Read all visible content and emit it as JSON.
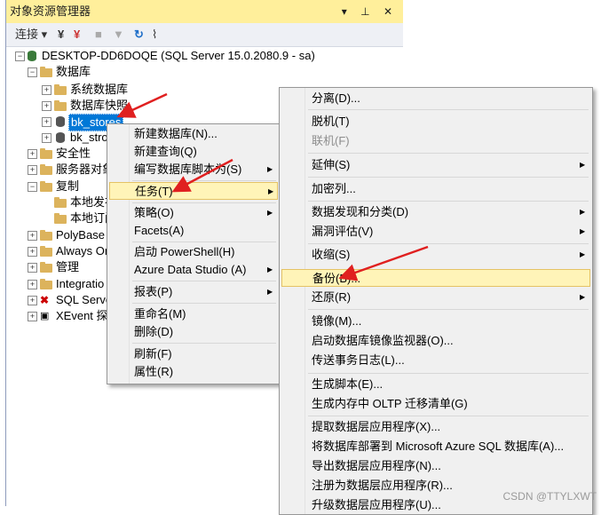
{
  "explorer": {
    "title": "对象资源管理器",
    "window_controls": "▾ ⊥ ✕",
    "toolbar": {
      "connect": "连接 ▾"
    },
    "tree": {
      "server": "DESKTOP-DD6DOQE (SQL Server 15.0.2080.9 - sa)",
      "databases": "数据库",
      "system_db": "系统数据库",
      "snapshots": "数据库快照",
      "bk_stores_1": "bk_stores",
      "bk_stores_2": "bk_stro",
      "security": "安全性",
      "server_objects": "服务器对象",
      "replication": "复制",
      "local_pub": "本地发布",
      "local_sub": "本地订阅",
      "polybase": "PolyBase",
      "always_on": "Always On",
      "management": "管理",
      "integration": "Integratio",
      "sql_server": "SQL Serve",
      "xevent": "XEvent 探"
    }
  },
  "menu1": {
    "new_db": "新建数据库(N)...",
    "new_query": "新建查询(Q)",
    "script_db": "编写数据库脚本为(S)",
    "tasks": "任务(T)",
    "policies": "策略(O)",
    "facets": "Facets(A)",
    "powershell": "启动 PowerShell(H)",
    "azure_ds": "Azure Data Studio (A)",
    "reports": "报表(P)",
    "rename": "重命名(M)",
    "delete": "删除(D)",
    "refresh": "刷新(F)",
    "properties": "属性(R)"
  },
  "menu2": {
    "detach": "分离(D)...",
    "offline": "脱机(T)",
    "online": "联机(F)",
    "stretch": "延伸(S)",
    "encrypt": "加密列...",
    "data_discovery": "数据发现和分类(D)",
    "vuln": "漏洞评估(V)",
    "shrink": "收缩(S)",
    "backup": "备份(B)...",
    "restore": "还原(R)",
    "mirror": "镜像(M)...",
    "mirror_monitor": "启动数据库镜像监视器(O)...",
    "log_shipping": "传送事务日志(L)...",
    "gen_scripts": "生成脚本(E)...",
    "oltp": "生成内存中 OLTP 迁移清单(G)",
    "extract": "提取数据层应用程序(X)...",
    "deploy_azure": "将数据库部署到 Microsoft Azure SQL 数据库(A)...",
    "export": "导出数据层应用程序(N)...",
    "register": "注册为数据层应用程序(R)...",
    "upgrade": "升级数据层应用程序(U)..."
  },
  "watermark": "CSDN @TTYLXWT",
  "colors": {
    "selection": "#0078d7",
    "highlight": "#fff4b8",
    "title_bar": "#ffef9b",
    "arrow": "#e02020"
  }
}
